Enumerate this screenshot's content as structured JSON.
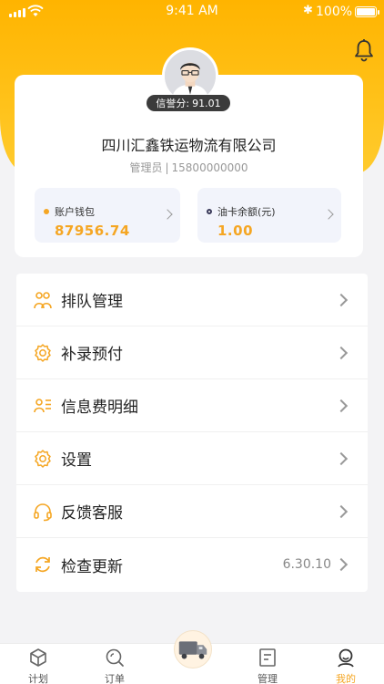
{
  "status_bar": {
    "time": "9:41 AM",
    "battery": "100%",
    "bluetooth_glyph": "✱",
    "battery_level": 1.0
  },
  "profile": {
    "credit_label": "信誉分:",
    "credit_score": "91.01",
    "company": "四川汇鑫铁运物流有限公司",
    "role": "管理员",
    "separator": "|",
    "phone": "15800000000"
  },
  "wallets": [
    {
      "label": "账户钱包",
      "amount": "87956.74",
      "dot_color": "#f5a623"
    },
    {
      "label": "油卡余额(元)",
      "amount": "1.00",
      "dot_color": "#3a3a5a"
    }
  ],
  "menu": [
    {
      "label": "排队管理",
      "icon": "queue-icon"
    },
    {
      "label": "补录预付",
      "icon": "gear-icon"
    },
    {
      "label": "信息费明细",
      "icon": "info-fee-icon"
    },
    {
      "label": "设置",
      "icon": "settings-icon"
    },
    {
      "label": "反馈客服",
      "icon": "headset-icon"
    },
    {
      "label": "检查更新",
      "icon": "refresh-icon",
      "value": "6.30.10"
    }
  ],
  "tabs": [
    {
      "label": "计划",
      "icon": "box-icon"
    },
    {
      "label": "订单",
      "icon": "order-search-icon"
    },
    {
      "label": "管理",
      "icon": "document-icon"
    },
    {
      "label": "我的",
      "icon": "profile-icon",
      "active": true
    }
  ],
  "colors": {
    "accent": "#f5a623",
    "hero": "#ffb400",
    "text": "#222222"
  }
}
